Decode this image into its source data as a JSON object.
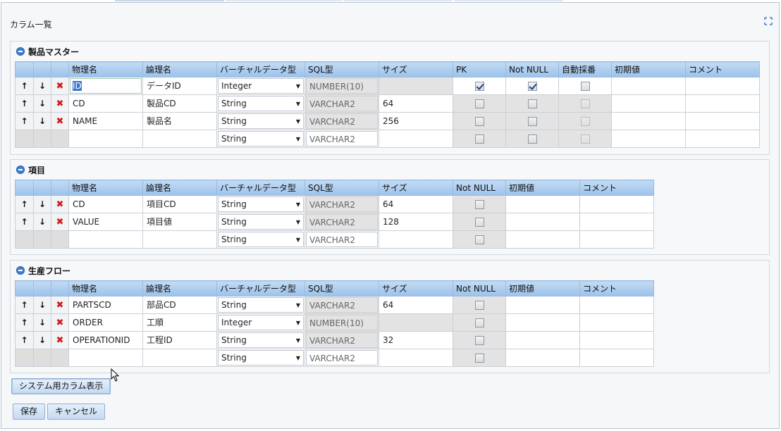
{
  "panel": {
    "title": "カラム一覧"
  },
  "columns_full": [
    "物理名",
    "論理名",
    "バーチャルデータ型",
    "SQL型",
    "サイズ",
    "PK",
    "Not NULL",
    "自動採番",
    "初期値",
    "コメント"
  ],
  "columns_short": [
    "物理名",
    "論理名",
    "バーチャルデータ型",
    "SQL型",
    "サイズ",
    "Not NULL",
    "初期値",
    "コメント"
  ],
  "row_controls": {
    "up": "↑",
    "down": "↓",
    "delete": "✖"
  },
  "sections": [
    {
      "title": "製品マスター",
      "rows": [
        {
          "physical": "ID",
          "logical": "データID",
          "vtype": "Integer",
          "sqltype": "NUMBER(10)",
          "size": "",
          "pk": true,
          "notnull": true,
          "auto": false
        },
        {
          "physical": "CD",
          "logical": "製品CD",
          "vtype": "String",
          "sqltype": "VARCHAR2",
          "size": "64",
          "pk": false,
          "notnull": false,
          "auto": false
        },
        {
          "physical": "NAME",
          "logical": "製品名",
          "vtype": "String",
          "sqltype": "VARCHAR2",
          "size": "256",
          "pk": false,
          "notnull": false,
          "auto": false
        },
        {
          "physical": "",
          "logical": "",
          "vtype": "String",
          "sqltype": "VARCHAR2",
          "size": "",
          "pk": false,
          "notnull": false,
          "auto": false
        }
      ]
    },
    {
      "title": "項目",
      "rows": [
        {
          "physical": "CD",
          "logical": "項目CD",
          "vtype": "String",
          "sqltype": "VARCHAR2",
          "size": "64",
          "notnull": false
        },
        {
          "physical": "VALUE",
          "logical": "項目値",
          "vtype": "String",
          "sqltype": "VARCHAR2",
          "size": "128",
          "notnull": false
        },
        {
          "physical": "",
          "logical": "",
          "vtype": "String",
          "sqltype": "VARCHAR2",
          "size": "",
          "notnull": false
        }
      ]
    },
    {
      "title": "生産フロー",
      "rows": [
        {
          "physical": "PARTSCD",
          "logical": "部品CD",
          "vtype": "String",
          "sqltype": "VARCHAR2",
          "size": "64",
          "notnull": false
        },
        {
          "physical": "ORDER",
          "logical": "工順",
          "vtype": "Integer",
          "sqltype": "NUMBER(10)",
          "size": "",
          "notnull": false
        },
        {
          "physical": "OPERATIONID",
          "logical": "工程ID",
          "vtype": "String",
          "sqltype": "VARCHAR2",
          "size": "32",
          "notnull": false
        },
        {
          "physical": "",
          "logical": "",
          "vtype": "String",
          "sqltype": "VARCHAR2",
          "size": "",
          "notnull": false
        }
      ]
    }
  ],
  "buttons": {
    "system_columns": "システム用カラム表示",
    "save": "保存",
    "cancel": "キャンセル"
  },
  "icons": {
    "section_toggle": "collapse-icon",
    "panel_tool": "maximize-icon",
    "cursor": "mouse-cursor-icon"
  },
  "colors": {
    "header_top": "#c3dbf4",
    "header_bottom": "#9cc2ea",
    "delete": "#d01a1a",
    "accent": "#3f7fd0"
  }
}
